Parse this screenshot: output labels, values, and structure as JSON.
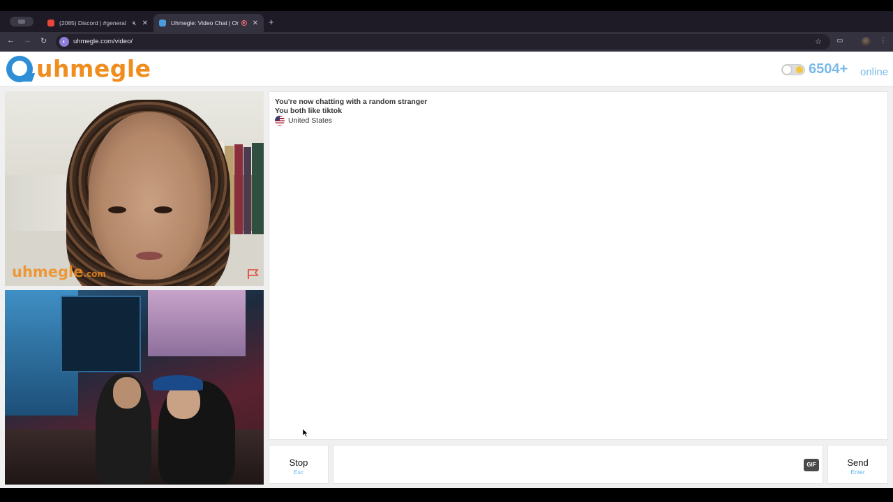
{
  "browser": {
    "tabs": [
      {
        "title": "(2085) Discord | #general",
        "icon": "discord-icon",
        "muted": true
      },
      {
        "title": "Uhmegle: Video Chat | Or",
        "icon": "uhmegle-icon",
        "recording": true
      }
    ],
    "url": "uhmegle.com/video/"
  },
  "site": {
    "logo_text": "uhmegle",
    "online_count": "6504+",
    "online_label": "online"
  },
  "video": {
    "watermark": "uhmegle",
    "watermark_suffix": ".com"
  },
  "chat": {
    "messages": [
      "You're now chatting with a random stranger",
      "You both like tiktok"
    ],
    "country": "United States"
  },
  "controls": {
    "stop_label": "Stop",
    "stop_key": "Esc",
    "send_label": "Send",
    "send_key": "Enter",
    "gif_label": "GIF",
    "input_value": ""
  },
  "colors": {
    "brand_orange": "#f08d1f",
    "brand_blue": "#2e8fd6",
    "online_blue": "#7ab9e8",
    "key_hint_blue": "#5fb8ea"
  }
}
